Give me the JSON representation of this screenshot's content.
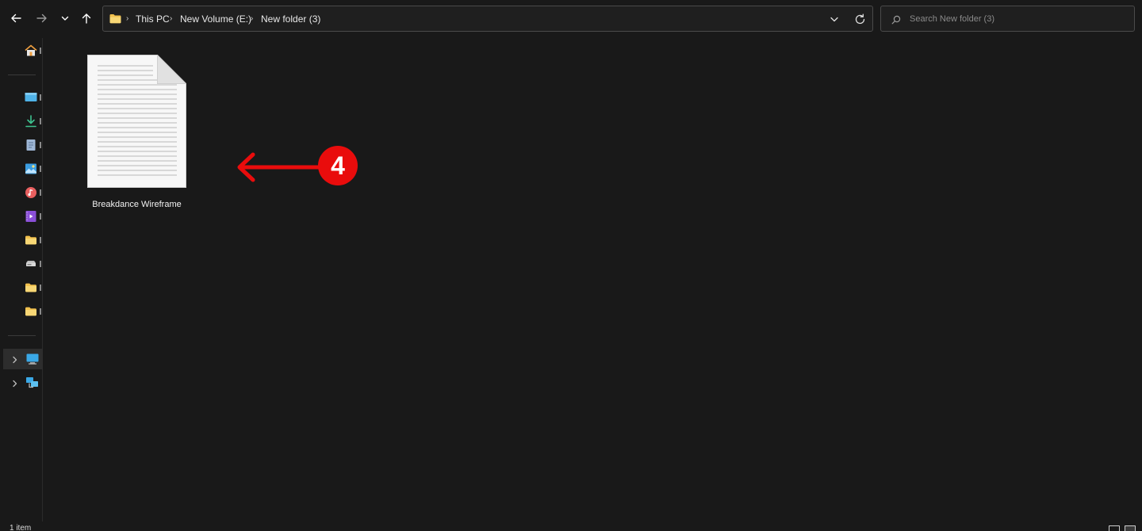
{
  "window": {
    "app": "File Explorer"
  },
  "navigation": {
    "back_icon": "arrow-left-icon",
    "forward_icon": "arrow-right-icon",
    "recent_icon": "chevron-down-icon",
    "up_icon": "arrow-up-icon"
  },
  "address": {
    "folder_icon": "folder-icon",
    "crumbs": [
      "This PC",
      "New Volume (E:)",
      "New folder (3)"
    ],
    "separator": "›"
  },
  "search": {
    "placeholder": "Search New folder (3)",
    "value": ""
  },
  "sidebar": {
    "items": [
      {
        "icon": "home-icon"
      },
      {
        "icon": "desktop-icon"
      },
      {
        "icon": "downloads-icon"
      },
      {
        "icon": "documents-icon"
      },
      {
        "icon": "pictures-icon"
      },
      {
        "icon": "music-icon"
      },
      {
        "icon": "videos-icon"
      },
      {
        "icon": "folder-icon"
      },
      {
        "icon": "drive-icon"
      },
      {
        "icon": "folder-icon"
      },
      {
        "icon": "folder-icon"
      }
    ],
    "tree": [
      {
        "icon": "this-pc-icon",
        "selected": true
      },
      {
        "icon": "network-icon",
        "selected": false
      }
    ]
  },
  "files": [
    {
      "name": "Breakdance Wireframe",
      "icon": "text-document-icon"
    }
  ],
  "annotation": {
    "step": "4",
    "color": "#e90c0c"
  },
  "status": {
    "item_count": "1 item"
  },
  "colors": {
    "background": "#191919",
    "border": "#4a4a4a",
    "folder": "#f2c14e",
    "accent": "#e90c0c"
  }
}
